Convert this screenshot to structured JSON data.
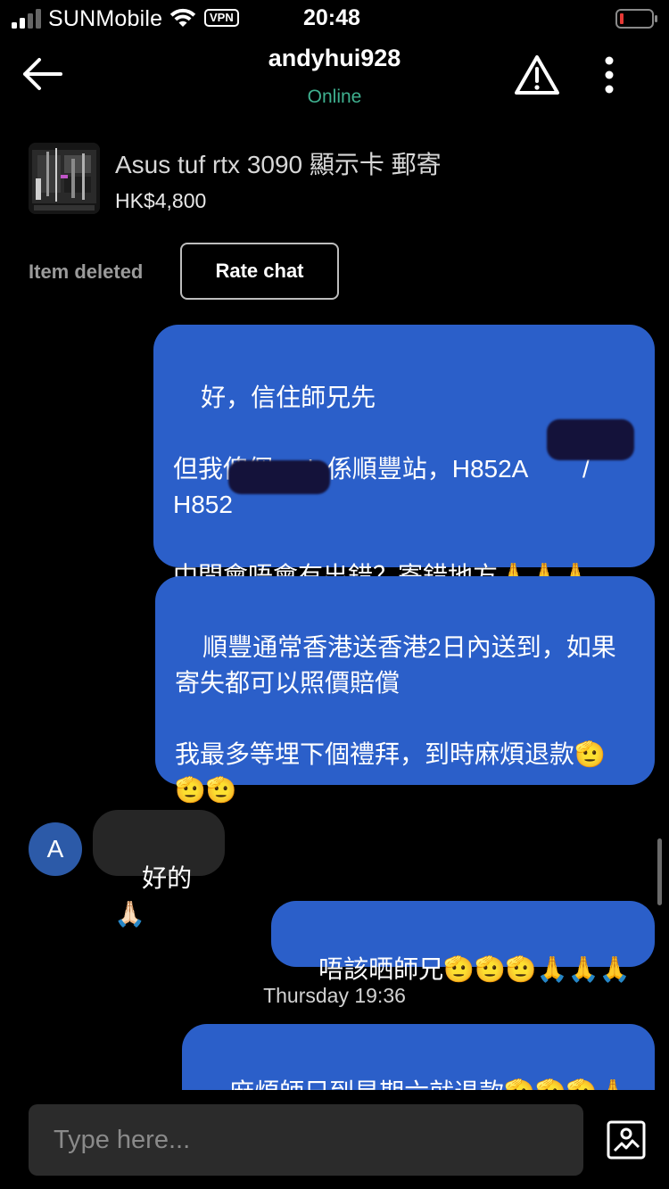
{
  "status_bar": {
    "carrier": "SUNMobile",
    "vpn": "VPN",
    "time": "20:48",
    "battery_color": "#e53935"
  },
  "header": {
    "username": "andyhui928",
    "status": "Online",
    "status_color": "#3fb08f"
  },
  "item": {
    "title": "Asus tuf rtx 3090 顯示卡 郵寄",
    "price": "HK$4,800",
    "deleted_label": "Item deleted",
    "rate_label": "Rate chat"
  },
  "messages": [
    {
      "from": "me",
      "text": "好，信住師兄先\n\n但我俾個code係順豐站，H852A        /\nH852\n\n中間會唔會有出錯？寄錯地方🙏🙏🙏"
    },
    {
      "from": "me",
      "text": "順豐通常香港送香港2日內送到，如果\n寄失都可以照價賠償\n\n我最多等埋下個禮拜，到時麻煩退款🫡\n🫡🫡"
    },
    {
      "from": "them",
      "avatar_letter": "A",
      "text": "好的🙏🏻"
    },
    {
      "from": "me",
      "text": "唔該晒師兄🫡🫡🫡🙏🙏🙏"
    },
    {
      "from": "me",
      "text": "麻煩師兄到星期六就退款🫡🫡🫡🙏\n🙏🙏"
    }
  ],
  "timestamp": "Thursday 19:36",
  "composer": {
    "placeholder": "Type here..."
  },
  "colors": {
    "my_bubble": "#2b5fc9",
    "their_bubble": "#262626",
    "background": "#000000"
  },
  "icons": [
    "back-arrow-icon",
    "warning-icon",
    "more-vertical-icon",
    "wifi-icon",
    "signal-icon",
    "battery-icon",
    "image-upload-icon"
  ]
}
